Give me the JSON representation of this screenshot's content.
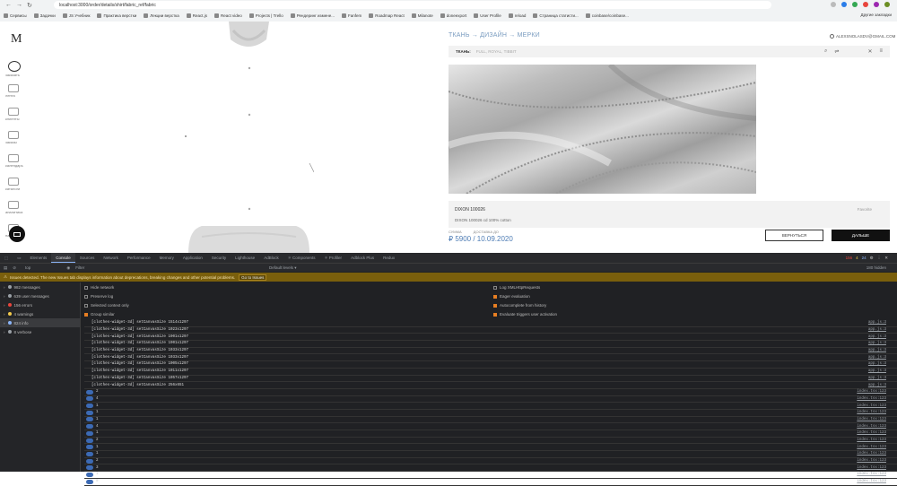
{
  "browser": {
    "url": "localhost:3000/order/details/shirt/fabric_ref/fabric",
    "bookmarks": [
      "Сервисы",
      "Задачки",
      "JS Учебник",
      "Практика верстки",
      "Лекции верстка",
      "React.js",
      "React video",
      "Projects | Trello",
      "Рендеринг измене...",
      "Fanfem",
      "Roadmap React",
      "Milanote",
      "doneexport",
      "User Profile",
      "reload",
      "Страница статисти...",
      "coinbase/coinbase..."
    ],
    "other_bookmarks": "Другие закладки"
  },
  "app": {
    "logo": "M",
    "sidebar": [
      {
        "label": "заказать",
        "active": true
      },
      {
        "label": "лента",
        "active": false
      },
      {
        "label": "клиенты",
        "active": false
      },
      {
        "label": "заказы",
        "active": false
      },
      {
        "label": "календарь",
        "active": false
      },
      {
        "label": "каталоги",
        "active": false
      },
      {
        "label": "аналитика",
        "active": false
      },
      {
        "label": "настройки",
        "active": false
      }
    ],
    "breadcrumb": "ТКАНЬ → ДИЗАЙН → МЕРКИ",
    "user_email": "ALEXSNOLASDV@GMAIL.COM",
    "search": {
      "label": "ТКАНЬ:",
      "placeholder": "FULL, ROYAL, TIBBIT"
    },
    "fabric": {
      "code": "DIXON 100026",
      "favorite": "Favorite",
      "description": "DIXON 100026 cd 100% cotton"
    },
    "summary_label": "СУММА",
    "delivery_label": "ДОСТАВКА ДО",
    "summary": "₽ 5900 / 10.09.2020",
    "back_button": "ВЕРНУТЬСЯ",
    "next_button": "ДАЛЬШЕ"
  },
  "devtools": {
    "tabs": [
      "Elements",
      "Console",
      "Sources",
      "Network",
      "Performance",
      "Memory",
      "Application",
      "Security",
      "Lighthouse",
      "AdBlock",
      "⚛ Components",
      "⚛ Profiler",
      "Adblock Plus",
      "Redux"
    ],
    "selected_tab": "Console",
    "counters": {
      "errors": "156",
      "warnings": "4",
      "info": "24"
    },
    "context": "top",
    "filter_placeholder": "Filter",
    "levels": "Default levels ▾",
    "hidden": "180 hidden",
    "issue_text": "Issues detected. The new Issues tab displays information about deprecations, breaking changes and other potential problems.",
    "issue_button": "Go to Issues",
    "sidebar_filters": [
      {
        "label": "982 messages",
        "color": "#9aa0a6"
      },
      {
        "label": "639 user messages",
        "color": "#9aa0a6"
      },
      {
        "label": "156 errors",
        "color": "#e8453c"
      },
      {
        "label": "4 warnings",
        "color": "#f2c94c"
      },
      {
        "label": "824 info",
        "color": "#8ab4f8"
      },
      {
        "label": "8 verbose",
        "color": "#9aa0a6"
      }
    ],
    "options_left": [
      {
        "label": "Hide network",
        "on": false
      },
      {
        "label": "Preserve log",
        "on": false
      },
      {
        "label": "Selected context only",
        "on": false
      },
      {
        "label": "Group similar",
        "on": true
      }
    ],
    "options_right": [
      {
        "label": "Log XMLHttpRequests",
        "on": false
      },
      {
        "label": "Eager evaluation",
        "on": true
      },
      {
        "label": "Autocomplete from history",
        "on": true
      },
      {
        "label": "Evaluate triggers user activation",
        "on": true
      }
    ],
    "log_rows": [
      {
        "msg": "[clothes-widget-3d] setCanvasSize 1514x1297",
        "src": "app.js:3"
      },
      {
        "msg": "[clothes-widget-3d] setCanvasSize 1023x1297",
        "src": "app.js:3"
      },
      {
        "msg": "[clothes-widget-3d] setCanvasSize 1901x1297",
        "src": "app.js:3"
      },
      {
        "msg": "[clothes-widget-3d] setCanvasSize 1901x1297",
        "src": "app.js:3"
      },
      {
        "msg": "[clothes-widget-3d] setCanvasSize 1033x1297",
        "src": "app.js:3"
      },
      {
        "msg": "[clothes-widget-3d] setCanvasSize 1033x1297",
        "src": "app.js:3"
      },
      {
        "msg": "[clothes-widget-3d] setCanvasSize 1005x1297",
        "src": "app.js:3"
      },
      {
        "msg": "[clothes-widget-3d] setCanvasSize 1011x1297",
        "src": "app.js:3"
      },
      {
        "msg": "[clothes-widget-3d] setCanvasSize 1057x1297",
        "src": "app.js:3"
      },
      {
        "msg": "[clothes-widget-3d] setCanvasSize 256x651",
        "src": "app.js:3"
      }
    ],
    "group_rows": [
      {
        "n": "2",
        "src": "index.tsx:123"
      },
      {
        "n": "4",
        "src": "index.tsx:123"
      },
      {
        "n": "1",
        "src": "index.tsx:123"
      },
      {
        "n": "1",
        "src": "index.tsx:123"
      },
      {
        "n": "1",
        "src": "index.tsx:123"
      },
      {
        "n": "4",
        "src": "index.tsx:123"
      },
      {
        "n": "1",
        "src": "index.tsx:123"
      },
      {
        "n": "2",
        "src": "index.tsx:123"
      },
      {
        "n": "1",
        "src": "index.tsx:123"
      },
      {
        "n": "1",
        "src": "index.tsx:123"
      },
      {
        "n": "2",
        "src": "index.tsx:123"
      },
      {
        "n": "3",
        "src": "index.tsx:123"
      },
      {
        "n": "1",
        "src": "index.tsx:123"
      },
      {
        "n": "9",
        "src": "index.tsx:123"
      }
    ]
  }
}
